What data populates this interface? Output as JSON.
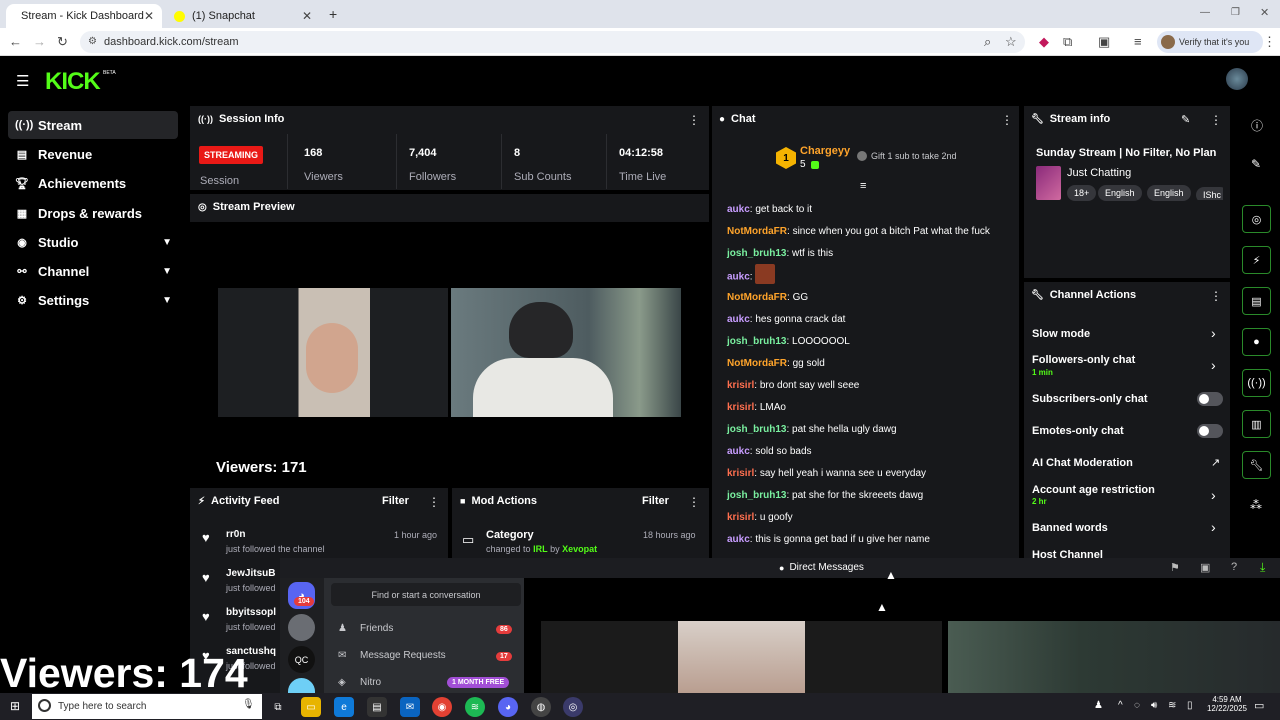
{
  "browser": {
    "tabs": [
      {
        "title": "Stream - Kick Dashboard",
        "active": true
      },
      {
        "title": "(1) Snapchat",
        "active": false
      }
    ],
    "url": "dashboard.kick.com/stream",
    "verify_label": "Verify that it's you"
  },
  "header": {
    "logo": "KICK",
    "beta": "BETA"
  },
  "sidebar": {
    "items": [
      {
        "label": "Stream",
        "icon": "broadcast-icon",
        "active": true
      },
      {
        "label": "Revenue",
        "icon": "revenue-icon"
      },
      {
        "label": "Achievements",
        "icon": "trophy-icon"
      },
      {
        "label": "Drops & rewards",
        "icon": "gift-icon"
      },
      {
        "label": "Studio",
        "icon": "studio-icon",
        "expandable": true
      },
      {
        "label": "Channel",
        "icon": "channel-icon",
        "expandable": true
      },
      {
        "label": "Settings",
        "icon": "gear-icon",
        "expandable": true
      }
    ]
  },
  "session": {
    "title": "Session Info",
    "badge": "STREAMING",
    "session_label": "Session",
    "stats": [
      {
        "value": "168",
        "label": "Viewers"
      },
      {
        "value": "7,404",
        "label": "Followers"
      },
      {
        "value": "8",
        "label": "Sub Counts"
      },
      {
        "value": "04:12:58",
        "label": "Time Live"
      }
    ]
  },
  "preview": {
    "title": "Stream Preview",
    "viewers_overlay": "Viewers: 171"
  },
  "activity": {
    "title": "Activity Feed",
    "filter": "Filter",
    "items": [
      {
        "name": "rr0n",
        "action": "just followed the channel",
        "time": "1 hour ago"
      },
      {
        "name": "JewJitsuB",
        "action": "just followed"
      },
      {
        "name": "bbyitssopl",
        "action": "just followed"
      },
      {
        "name": "sanctushq",
        "action": "just followed"
      }
    ]
  },
  "mod": {
    "title": "Mod Actions",
    "filter": "Filter",
    "item": {
      "title": "Category",
      "changed": "changed to",
      "value": "IRL",
      "by": "by",
      "user": "Xevopat",
      "time": "18 hours ago"
    }
  },
  "chat": {
    "title": "Chat",
    "top_gifter": {
      "name": "Chargeyy",
      "count": "5",
      "rank": "1"
    },
    "gift_prompt": "Gift 1 sub to take 2nd",
    "messages": [
      {
        "user": "aukc",
        "text": "get back to it",
        "color": "purple"
      },
      {
        "user": "NotMordaFR",
        "text": "since when you got a bitch Pat what the fuck",
        "color": "orange"
      },
      {
        "user": "josh_bruh13",
        "text": "wtf is this",
        "color": "green"
      },
      {
        "user": "aukc",
        "text": "",
        "color": "purple",
        "emote": true
      },
      {
        "user": "NotMordaFR",
        "text": "GG",
        "color": "orange"
      },
      {
        "user": "aukc",
        "text": "hes gonna crack dat",
        "color": "purple"
      },
      {
        "user": "josh_bruh13",
        "text": "LOOOOOOL",
        "color": "green"
      },
      {
        "user": "NotMordaFR",
        "text": "gg sold",
        "color": "orange"
      },
      {
        "user": "krisirl",
        "text": "bro dont say well seee",
        "color": "red"
      },
      {
        "user": "krisirl",
        "text": "LMAo",
        "color": "red"
      },
      {
        "user": "josh_bruh13",
        "text": "pat she hella ugly dawg",
        "color": "green"
      },
      {
        "user": "aukc",
        "text": "sold so bads",
        "color": "purple"
      },
      {
        "user": "krisirl",
        "text": "say hell yeah i wanna see u everyday",
        "color": "red"
      },
      {
        "user": "josh_bruh13",
        "text": "pat she for the skreeets dawg",
        "color": "green"
      },
      {
        "user": "krisirl",
        "text": "u goofy",
        "color": "red"
      },
      {
        "user": "aukc",
        "text": "this is gonna get bad if u give her name",
        "color": "purple"
      }
    ]
  },
  "stream_info": {
    "title": "Stream info",
    "stream_title": "Sunday Stream | No Filter, No Plan",
    "category": "Just Chatting",
    "tags": [
      "18+",
      "English",
      "English",
      "IShc"
    ]
  },
  "channel_actions": {
    "title": "Channel Actions",
    "items": [
      {
        "label": "Slow mode",
        "control": "chevron"
      },
      {
        "label": "Followers-only chat",
        "sub": "1 min",
        "control": "chevron"
      },
      {
        "label": "Subscribers-only chat",
        "control": "toggle"
      },
      {
        "label": "Emotes-only chat",
        "control": "toggle"
      },
      {
        "label": "AI Chat Moderation",
        "control": "external"
      },
      {
        "label": "Account age restriction",
        "sub": "2 hr",
        "control": "chevron"
      },
      {
        "label": "Banned words",
        "control": "chevron"
      },
      {
        "label": "Host Channel",
        "control": "none"
      }
    ]
  },
  "discord": {
    "search": "Find or start a conversation",
    "badge_count": "104",
    "items": [
      {
        "label": "Friends",
        "badge": "86"
      },
      {
        "label": "Message Requests",
        "badge": "17"
      },
      {
        "label": "Nitro",
        "badge": "1 MONTH FREE"
      }
    ]
  },
  "dm_bar": {
    "label": "Direct Messages"
  },
  "viewers_big": "Viewers: 174",
  "taskbar": {
    "search": "Type here to search",
    "time": "4:59 AM",
    "date": "12/22/2025"
  },
  "colors": {
    "kick_green": "#53fc18",
    "streaming_red": "#e91916",
    "panel": "#17181b"
  }
}
